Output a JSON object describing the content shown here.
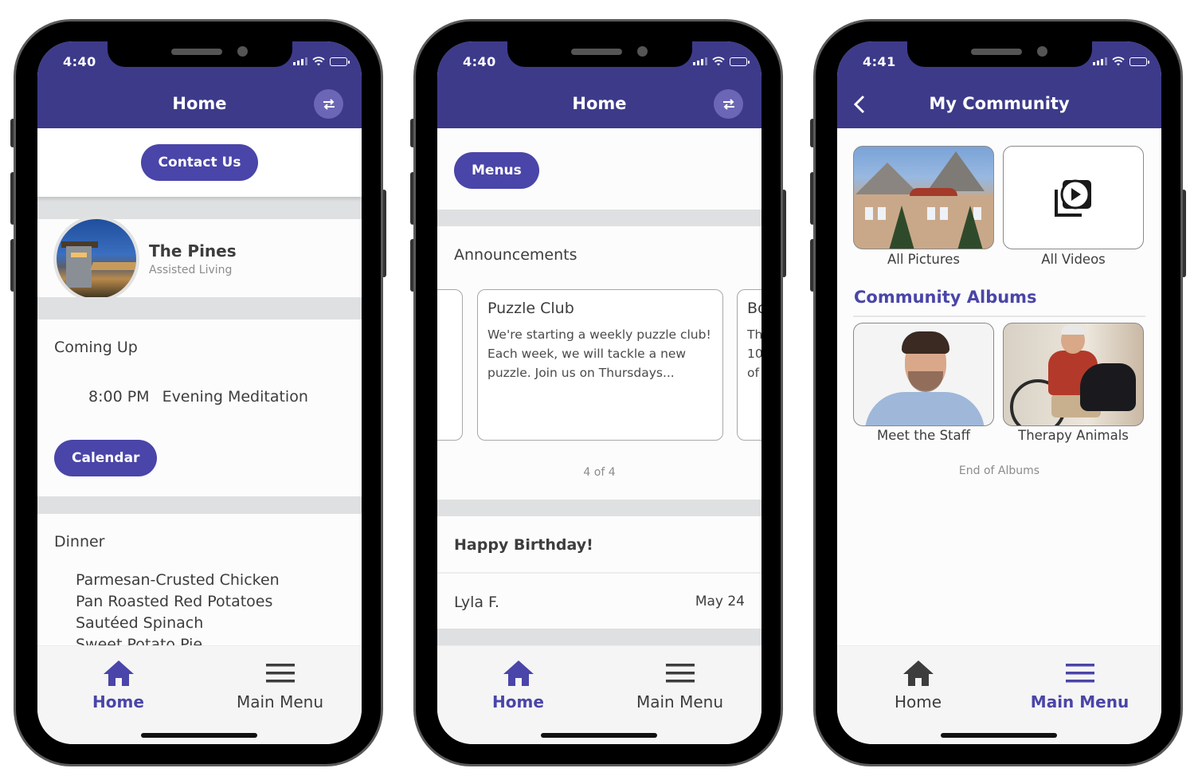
{
  "colors": {
    "brand": "#3d3a8a",
    "accent": "#4a45a8",
    "divider": "#dfe0e2",
    "text": "#3d3d3d",
    "muted": "#8c8c8c"
  },
  "phones": [
    {
      "status": {
        "time": "4:40"
      },
      "header": {
        "title": "Home",
        "action_icon": "swap-arrows-icon"
      },
      "contact_button": "Contact Us",
      "community": {
        "name": "The Pines",
        "type": "Assisted Living"
      },
      "coming_up": {
        "title": "Coming Up",
        "event": {
          "time": "8:00 PM",
          "name": "Evening Meditation"
        },
        "calendar_button": "Calendar"
      },
      "dinner": {
        "title": "Dinner",
        "items": [
          "Parmesan-Crusted Chicken",
          "Pan Roasted Red Potatoes",
          "Sautéed Spinach",
          "Sweet Potato Pie"
        ]
      },
      "tabbar": {
        "active": "home",
        "items": [
          {
            "id": "home",
            "label": "Home",
            "icon": "home-icon"
          },
          {
            "id": "menu",
            "label": "Main Menu",
            "icon": "hamburger-icon"
          }
        ]
      }
    },
    {
      "status": {
        "time": "4:40"
      },
      "header": {
        "title": "Home",
        "action_icon": "swap-arrows-icon"
      },
      "menus_button": "Menus",
      "announcements": {
        "title": "Announcements",
        "current": {
          "title": "Puzzle Club",
          "body": "We're starting a weekly puzzle club! Each week, we will tackle a new puzzle. Join us on Thursdays..."
        },
        "next_partial": {
          "title": "Bo",
          "lines": [
            "Th",
            "10",
            "of"
          ]
        },
        "pager": "4 of 4"
      },
      "birthdays": {
        "title": "Happy Birthday!",
        "items": [
          {
            "name": "Lyla F.",
            "date": "May 24"
          }
        ]
      },
      "tabbar": {
        "active": "home",
        "items": [
          {
            "id": "home",
            "label": "Home",
            "icon": "home-icon"
          },
          {
            "id": "menu",
            "label": "Main Menu",
            "icon": "hamburger-icon"
          }
        ]
      }
    },
    {
      "status": {
        "time": "4:41"
      },
      "header": {
        "title": "My Community",
        "back_icon": "chevron-left-icon"
      },
      "media": [
        {
          "label": "All Pictures",
          "type": "photo"
        },
        {
          "label": "All Videos",
          "type": "video",
          "icon": "video-play-icon"
        }
      ],
      "albums": {
        "title": "Community Albums",
        "items": [
          {
            "label": "Meet the Staff"
          },
          {
            "label": "Therapy Animals"
          }
        ],
        "end_text": "End of Albums"
      },
      "tabbar": {
        "active": "menu",
        "items": [
          {
            "id": "home",
            "label": "Home",
            "icon": "home-icon"
          },
          {
            "id": "menu",
            "label": "Main Menu",
            "icon": "hamburger-icon"
          }
        ]
      }
    }
  ]
}
